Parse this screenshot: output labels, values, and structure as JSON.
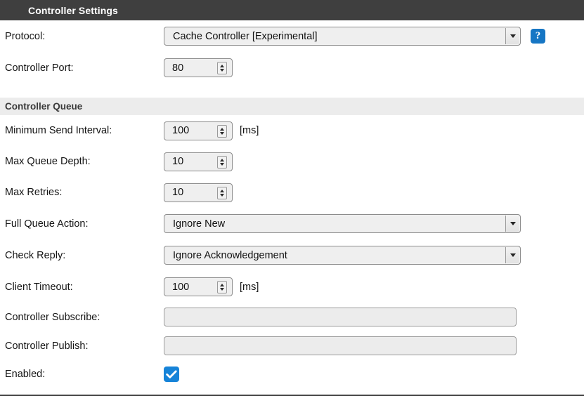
{
  "window": {
    "title": "Controller Settings"
  },
  "sections": {
    "controller_settings": {
      "protocol": {
        "label": "Protocol:",
        "value": "Cache Controller [Experimental]",
        "help_icon": "question-mark-icon",
        "help_glyph": "?"
      },
      "controller_port": {
        "label": "Controller Port:",
        "value": "80"
      }
    },
    "controller_queue": {
      "header": "Controller Queue",
      "minimum_send_interval": {
        "label": "Minimum Send Interval:",
        "value": "100",
        "unit": "[ms]"
      },
      "max_queue_depth": {
        "label": "Max Queue Depth:",
        "value": "10"
      },
      "max_retries": {
        "label": "Max Retries:",
        "value": "10"
      },
      "full_queue_action": {
        "label": "Full Queue Action:",
        "value": "Ignore New"
      },
      "check_reply": {
        "label": "Check Reply:",
        "value": "Ignore Acknowledgement"
      },
      "client_timeout": {
        "label": "Client Timeout:",
        "value": "100",
        "unit": "[ms]"
      },
      "controller_subscribe": {
        "label": "Controller Subscribe:",
        "value": "",
        "placeholder": ""
      },
      "controller_publish": {
        "label": "Controller Publish:",
        "value": "",
        "placeholder": ""
      },
      "enabled": {
        "label": "Enabled:",
        "checked": true
      }
    }
  },
  "colors": {
    "titlebar_background": "#3f3f3f",
    "titlebar_text": "#ffffff",
    "section_header_background": "#ececec",
    "accent_blue": "#1683d8",
    "help_blue": "#1676c4",
    "field_background": "#efefef",
    "field_border": "#8c8c8c"
  }
}
